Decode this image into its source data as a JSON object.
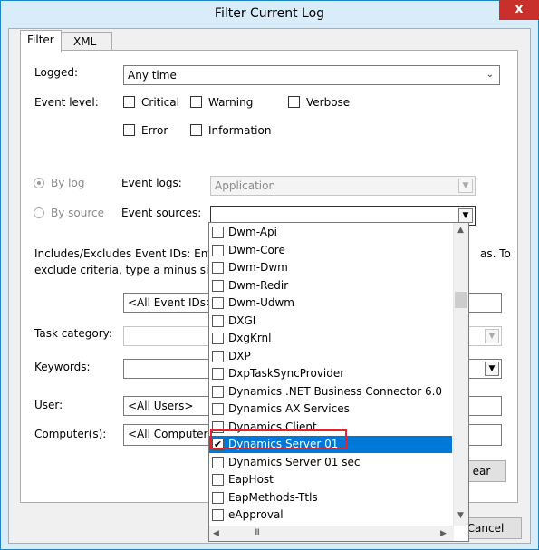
{
  "window": {
    "title": "Filter Current Log",
    "close_glyph": "x"
  },
  "tabs": [
    {
      "label": "Filter"
    },
    {
      "label": "XML"
    }
  ],
  "filter": {
    "logged_label": "Logged:",
    "logged_value": "Any time",
    "event_level_label": "Event level:",
    "levels": [
      "Critical",
      "Warning",
      "Verbose",
      "Error",
      "Information"
    ],
    "by_log_label": "By log",
    "by_source_label": "By source",
    "event_logs_label": "Event logs:",
    "event_logs_value": "Application",
    "event_sources_label": "Event sources:",
    "event_sources_value": "",
    "includes_text_left_1": "Includes/Excludes Event IDs: Enter",
    "includes_text_right_1": "as. To",
    "includes_text_left_2": "exclude criteria, type a minus sign",
    "event_ids_value": "<All Event IDs>",
    "task_category_label": "Task category:",
    "keywords_label": "Keywords:",
    "user_label": "User:",
    "user_value": "<All Users>",
    "computer_label": "Computer(s):",
    "computer_value": "<All Computers",
    "clear_fragment": "ear"
  },
  "footer": {
    "cancel_label": "Cancel"
  },
  "dropdown": {
    "items": [
      {
        "label": "Dwm-Api",
        "checked": false
      },
      {
        "label": "Dwm-Core",
        "checked": false
      },
      {
        "label": "Dwm-Dwm",
        "checked": false
      },
      {
        "label": "Dwm-Redir",
        "checked": false
      },
      {
        "label": "Dwm-Udwm",
        "checked": false
      },
      {
        "label": "DXGI",
        "checked": false
      },
      {
        "label": "DxgKrnl",
        "checked": false
      },
      {
        "label": "DXP",
        "checked": false
      },
      {
        "label": "DxpTaskSyncProvider",
        "checked": false
      },
      {
        "label": "Dynamics .NET Business Connector 6.0",
        "checked": false
      },
      {
        "label": "Dynamics AX Services",
        "checked": false
      },
      {
        "label": "Dynamics Client",
        "checked": false
      },
      {
        "label": "Dynamics Server 01",
        "checked": true
      },
      {
        "label": "Dynamics Server 01 sec",
        "checked": false
      },
      {
        "label": "EapHost",
        "checked": false
      },
      {
        "label": "EapMethods-Ttls",
        "checked": false
      },
      {
        "label": "eApproval",
        "checked": false
      }
    ],
    "selected_index": 12,
    "scroll_thumb_glyph": "III"
  },
  "colors": {
    "selection": "#0078d7",
    "highlight_outline": "#e8212a",
    "close_button": "#c9302c"
  }
}
